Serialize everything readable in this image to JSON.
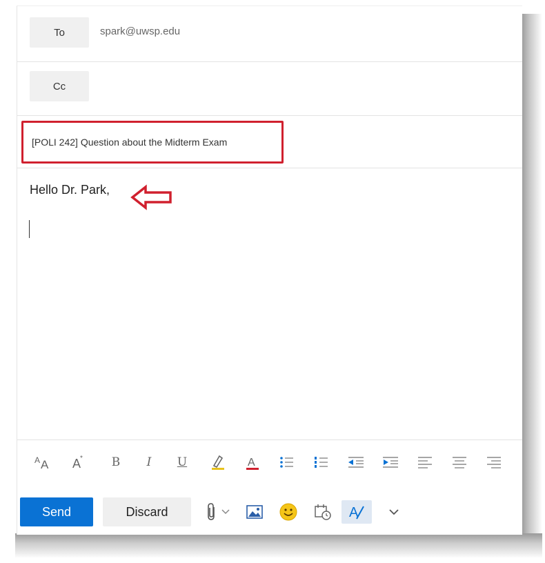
{
  "compose": {
    "to_label": "To",
    "to_value": "spark@uwsp.edu",
    "cc_label": "Cc",
    "subject_value": "[POLI 242] Question about the Midterm Exam",
    "body_greeting": "Hello Dr. Park,"
  },
  "annotations": {
    "highlight_color": "#d0202e",
    "arrow": "left-arrow-outline"
  },
  "format_toolbar": {
    "items": [
      {
        "name": "font-size-icon"
      },
      {
        "name": "grow-font-icon"
      },
      {
        "name": "bold-icon",
        "glyph": "B"
      },
      {
        "name": "italic-icon",
        "glyph": "I"
      },
      {
        "name": "underline-icon",
        "glyph": "U"
      },
      {
        "name": "highlight-icon"
      },
      {
        "name": "font-color-icon",
        "glyph": "A"
      },
      {
        "name": "bullets-icon"
      },
      {
        "name": "numbering-icon"
      },
      {
        "name": "decrease-indent-icon"
      },
      {
        "name": "increase-indent-icon"
      },
      {
        "name": "align-left-icon"
      },
      {
        "name": "align-center-icon"
      },
      {
        "name": "align-right-icon"
      }
    ]
  },
  "actions": {
    "send_label": "Send",
    "discard_label": "Discard",
    "icons": [
      "attach-icon",
      "chevron-down-icon",
      "insert-picture-icon",
      "emoji-icon",
      "schedule-send-icon",
      "editor-icon",
      "more-options-icon"
    ]
  },
  "colors": {
    "send_button": "#0a72d4",
    "highlight_yellow": "#e8c21c",
    "font_color_red": "#d0202e",
    "accent_blue": "#0a72d4"
  }
}
